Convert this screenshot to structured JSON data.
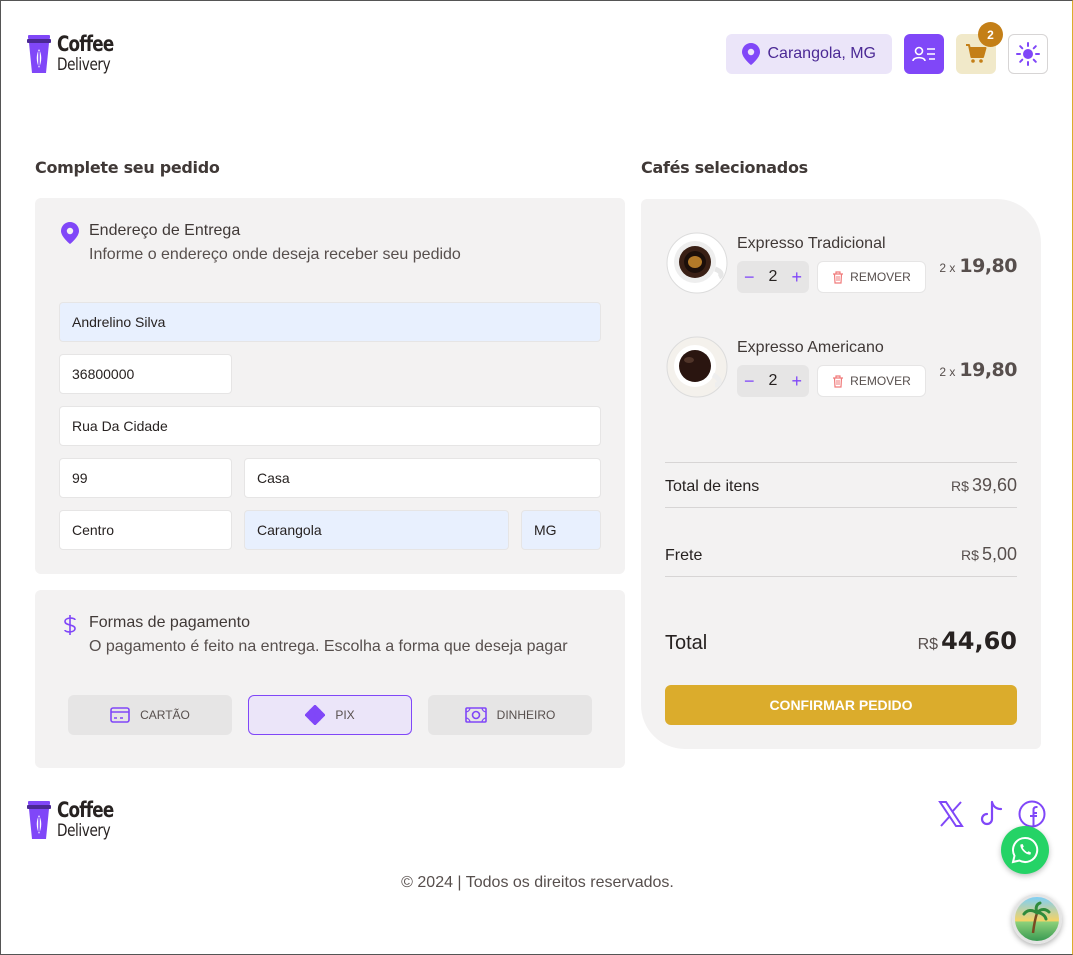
{
  "brand": {
    "line1": "Coffee",
    "line2": "Delivery"
  },
  "header": {
    "location": "Carangola, MG",
    "cart_count": "2",
    "colors": {
      "purple": "#8047f8",
      "purple_light": "#ebe5f9",
      "yellow": "#dbac2c",
      "yellow_dark": "#c47f17"
    }
  },
  "checkout": {
    "title": "Complete seu pedido",
    "address": {
      "title": "Endereço de Entrega",
      "subtitle": "Informe o endereço onde deseja receber seu pedido",
      "name": "Andrelino Silva",
      "cep": "36800000",
      "street": "Rua Da Cidade",
      "number": "99",
      "complement": "Casa",
      "neighborhood": "Centro",
      "city": "Carangola",
      "uf": "MG"
    },
    "payment": {
      "title": "Formas de pagamento",
      "subtitle": "O pagamento é feito na entrega. Escolha a forma que deseja pagar",
      "options": [
        {
          "label": "CARTÃO",
          "icon": "credit-card-icon"
        },
        {
          "label": "PIX",
          "icon": "pix-icon",
          "selected": true
        },
        {
          "label": "DINHEIRO",
          "icon": "money-icon"
        }
      ]
    }
  },
  "cart": {
    "title": "Cafés selecionados",
    "items": [
      {
        "name": "Expresso Tradicional",
        "qty": "2",
        "remove": "REMOVER",
        "mult": "2 x",
        "price": "19,80"
      },
      {
        "name": "Expresso Americano",
        "qty": "2",
        "remove": "REMOVER",
        "mult": "2 x",
        "price": "19,80"
      }
    ],
    "stepper": {
      "minus": "−",
      "plus": "+"
    },
    "currency": "R$",
    "items_total_label": "Total de itens",
    "items_total": "39,60",
    "shipping_label": "Frete",
    "shipping": "5,00",
    "total_label": "Total",
    "total": "44,60",
    "confirm": "CONFIRMAR PEDIDO"
  },
  "footer": {
    "copyright": "© 2024 | Todos os direitos reservados.",
    "socials": [
      "x-icon",
      "tiktok-icon",
      "facebook-icon"
    ]
  }
}
